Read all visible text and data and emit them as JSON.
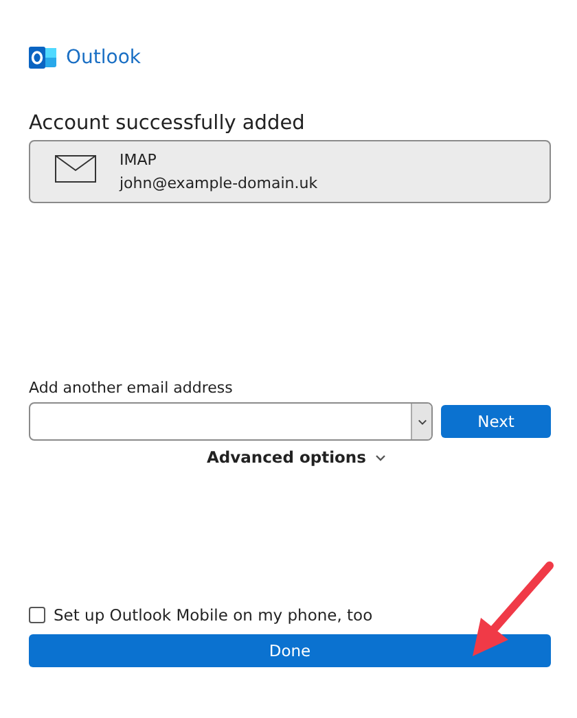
{
  "app": {
    "name": "Outlook"
  },
  "heading": "Account successfully added",
  "account": {
    "type": "IMAP",
    "email": "john@example-domain.uk"
  },
  "add_email": {
    "label": "Add another email address",
    "button": "Next"
  },
  "advanced_options": {
    "label": "Advanced options",
    "expanded": false
  },
  "mobile_setup": {
    "label": "Set up Outlook Mobile on my phone, too",
    "checked": false
  },
  "done_button": "Done"
}
